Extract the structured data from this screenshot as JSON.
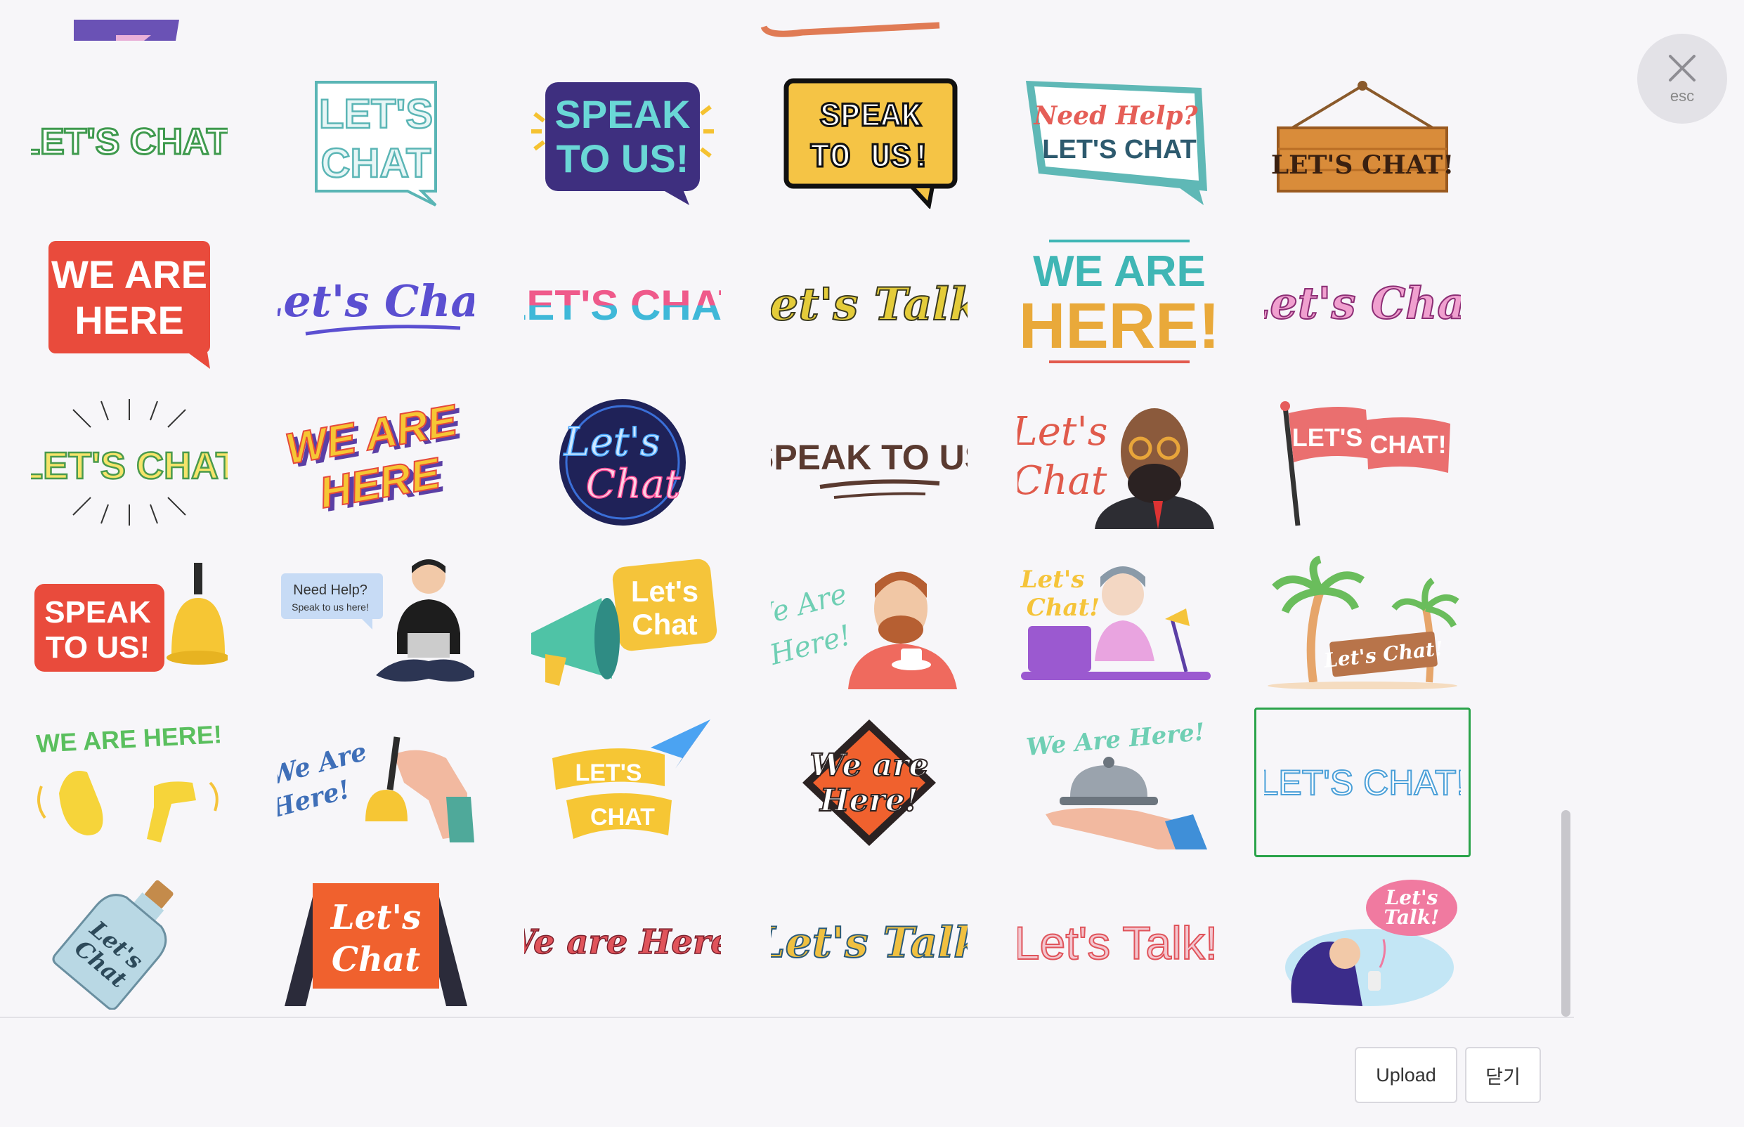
{
  "stickers": [
    {
      "text": "LET'S CHAT!",
      "style": "outlined-green"
    },
    {
      "text": "LET'S CHAT",
      "style": "speech-outline"
    },
    {
      "text": "SPEAK TO US!",
      "style": "navy-bubble"
    },
    {
      "text": "SPEAK TO US!",
      "style": "pixel-yellow"
    },
    {
      "text": "Need Help? LET'S CHAT",
      "style": "teal-sign"
    },
    {
      "text": "LET'S CHAT!",
      "style": "wood-sign"
    },
    {
      "text": "WE ARE HERE",
      "style": "red-bubble"
    },
    {
      "text": "Let's Chat",
      "style": "blue-script"
    },
    {
      "text": "LET'S CHAT",
      "style": "gradient-caps"
    },
    {
      "text": "Let's Talk!",
      "style": "yellow-script"
    },
    {
      "text": "WE ARE HERE!",
      "style": "multicolor-block"
    },
    {
      "text": "Let's Chat",
      "style": "pink-script"
    },
    {
      "text": "LET'S CHAT",
      "style": "burst"
    },
    {
      "text": "WE ARE HERE",
      "style": "3d-yellow"
    },
    {
      "text": "Let's Chat",
      "style": "neon-circle"
    },
    {
      "text": "SPEAK TO US",
      "style": "brown-brush"
    },
    {
      "text": "Let's Chat",
      "style": "man-glasses"
    },
    {
      "text": "LET'S CHAT!",
      "style": "flag"
    },
    {
      "text": "SPEAK TO US!",
      "style": "bell"
    },
    {
      "text": "Need Help?",
      "subtext": "Speak to us here!",
      "style": "laptop-man"
    },
    {
      "text": "Let's Chat",
      "style": "megaphone"
    },
    {
      "text": "We Are Here!",
      "style": "tea-man"
    },
    {
      "text": "Let's Chat!",
      "style": "desk-man"
    },
    {
      "text": "Let's Chat!",
      "style": "palm-sign"
    },
    {
      "text": "WE ARE HERE!",
      "style": "hands"
    },
    {
      "text": "We Are Here!",
      "style": "hand-bell"
    },
    {
      "text": "LET'S CHAT",
      "style": "paper-plane"
    },
    {
      "text": "We are Here!",
      "style": "diamond"
    },
    {
      "text": "We Are Here!",
      "style": "service-bell"
    },
    {
      "text": "LET'S CHAT!",
      "style": "thin-outline",
      "selected": true
    },
    {
      "text": "Let's Chat",
      "style": "bottle"
    },
    {
      "text": "Let's Chat",
      "style": "a-frame"
    },
    {
      "text": "We are Here!",
      "style": "red-script"
    },
    {
      "text": "Let's Talk",
      "style": "gold-script"
    },
    {
      "text": "Let's Talk!",
      "style": "striped"
    },
    {
      "text": "Let's Talk!",
      "style": "woman-phone"
    }
  ],
  "footer": {
    "upload_label": "Upload",
    "close_label": "닫기"
  },
  "esc": {
    "label": "esc"
  }
}
